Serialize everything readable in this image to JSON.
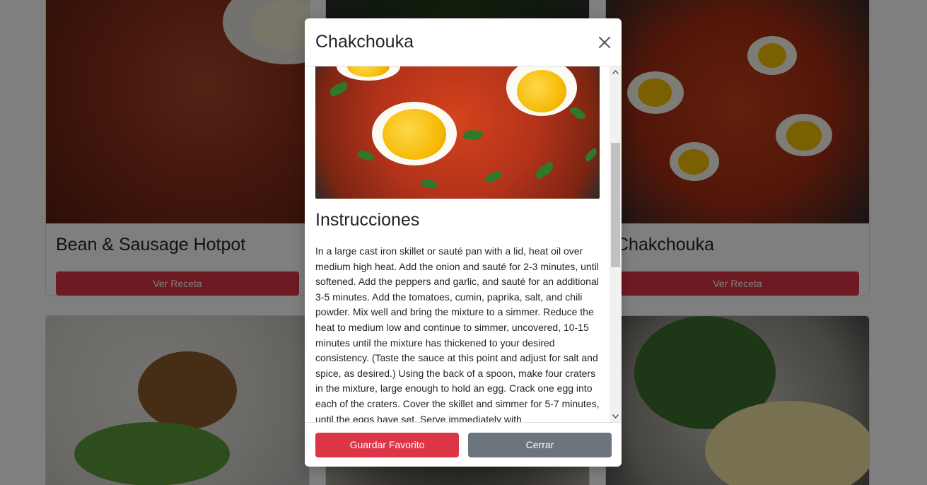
{
  "cards": [
    {
      "title": "Bean & Sausage Hotpot",
      "button_label": "Ver Receta",
      "image": "bean-sausage-hotpot"
    },
    {
      "title": "",
      "button_label": "",
      "image": "greens-dish"
    },
    {
      "title": "Chakchouka",
      "button_label": "Ver Receta",
      "image": "chakchouka"
    },
    {
      "title": "",
      "button_label": "",
      "image": "duck-confit"
    },
    {
      "title": "",
      "button_label": "",
      "image": "lentil-dish"
    },
    {
      "title": "",
      "button_label": "",
      "image": "omelette"
    }
  ],
  "modal": {
    "title": "Chakchouka",
    "close_icon": "close-icon",
    "section_title": "Instrucciones",
    "instructions": "In a large cast iron skillet or sauté pan with a lid, heat oil over medium high heat. Add the onion and sauté for 2-3 minutes, until softened. Add the peppers and garlic, and sauté for an additional 3-5 minutes. Add the tomatoes, cumin, paprika, salt, and chili powder. Mix well and bring the mixture to a simmer. Reduce the heat to medium low and continue to simmer, uncovered, 10-15 minutes until the mixture has thickened to your desired consistency. (Taste the sauce at this point and adjust for salt and spice, as desired.) Using the back of a spoon, make four craters in the mixture, large enough to hold an egg. Crack one egg into each of the craters. Cover the skillet and simmer for 5-7 minutes, until the eggs have set. Serve immediately with",
    "buttons": {
      "save_favorite": "Guardar Favorito",
      "close": "Cerrar"
    }
  },
  "colors": {
    "danger": "#dc3545",
    "secondary": "#6c757d",
    "backdrop": "rgba(0,0,0,0.5)"
  }
}
